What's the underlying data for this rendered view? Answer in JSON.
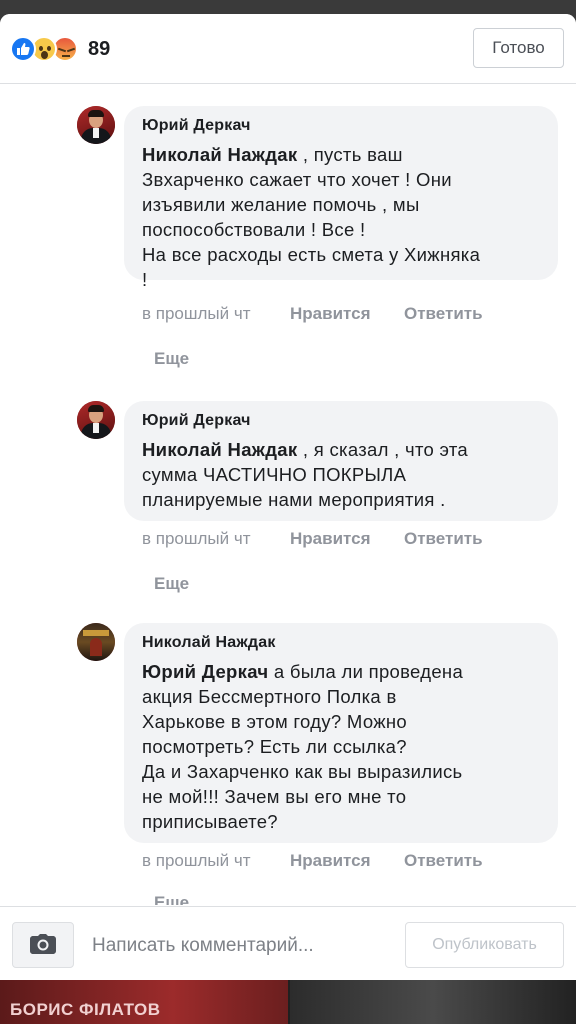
{
  "header": {
    "reactions": [
      "like",
      "wow",
      "angry"
    ],
    "reaction_count": "89",
    "done_label": "Готово"
  },
  "comments": [
    {
      "author": "Юрий Деркач",
      "mention": "Николай Наждак",
      "lines": [
        " , пусть ваш",
        "Звхарченко сажает что хочет ! Они",
        "изъявили желание помочь , мы",
        "поспособствовали ! Все !",
        "На все расходы есть смета у Хижняка",
        "!"
      ],
      "time": "в прошлый чт",
      "like_label": "Нравится",
      "reply_label": "Ответить",
      "more_label": "Еще"
    },
    {
      "author": "Юрий Деркач",
      "mention": "Николай Наждак",
      "lines": [
        " , я сказал , что эта",
        "сумма ЧАСТИЧНО ПОКРЫЛА",
        "планируемые нами мероприятия ."
      ],
      "time": "в прошлый чт",
      "like_label": "Нравится",
      "reply_label": "Ответить",
      "more_label": "Еще"
    },
    {
      "author": "Николай Наждак",
      "mention": "Юрий Деркач",
      "lines": [
        " а была ли проведена",
        "акция Бессмертного Полка в",
        "Харькове в этом году? Можно",
        "посмотреть? Есть ли ссылка?",
        "Да и Захарченко как вы выразились",
        "не мой!!! Зачем вы его мне то",
        "приписываете?"
      ],
      "time": "в прошлый чт",
      "like_label": "Нравится",
      "reply_label": "Ответить",
      "more_label": "Еще"
    }
  ],
  "composer": {
    "placeholder": "Написать комментарий...",
    "publish_label": "Опубликовать"
  },
  "background": {
    "caption": "БОРИС ФІЛАТОВ"
  }
}
